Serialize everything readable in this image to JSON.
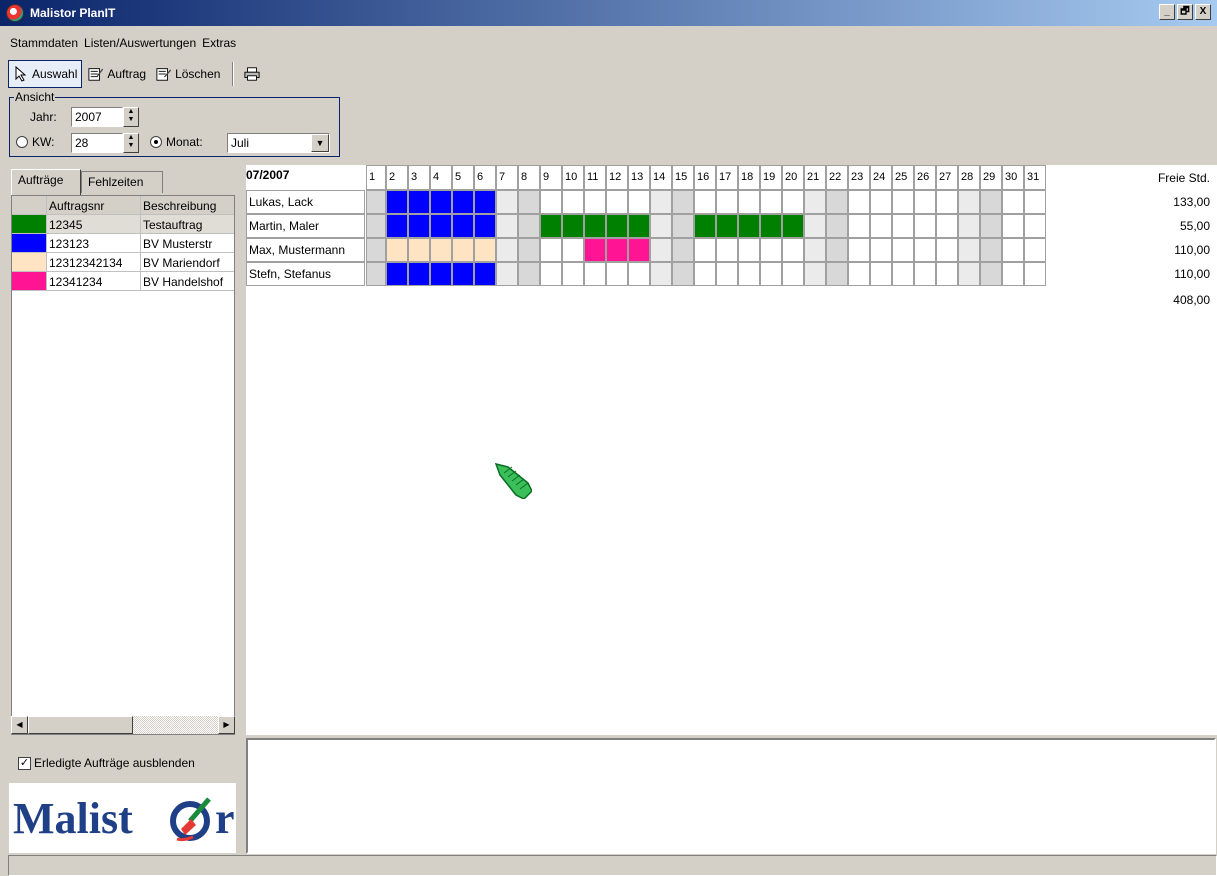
{
  "window": {
    "title": "Malistor PlanIT",
    "btn_min": "_",
    "btn_max": "🗗",
    "btn_close": "X"
  },
  "menu": [
    "Stammdaten",
    "Listen/Auswertungen",
    "Extras"
  ],
  "toolbar": {
    "select_label": "Auswahl",
    "order_label": "Auftrag",
    "delete_label": "Löschen"
  },
  "view": {
    "legend": "Ansicht",
    "year_label": "Jahr:",
    "year_value": "2007",
    "week_label": "KW:",
    "week_value": "28",
    "month_label": "Monat:",
    "month_value": "Juli",
    "mode": "month"
  },
  "left_tabs": [
    "Aufträge",
    "Fehlzeiten"
  ],
  "orders": {
    "col_nr": "Auftragsnr",
    "col_desc": "Beschreibung",
    "rows": [
      {
        "color": "#008000",
        "nr": "12345",
        "desc": "Testauftrag",
        "selected": true
      },
      {
        "color": "#0000ff",
        "nr": "123123",
        "desc": "BV Musterstr",
        "selected": false
      },
      {
        "color": "#ffe4c4",
        "nr": "12312342134",
        "desc": "BV Mariendorf",
        "selected": false
      },
      {
        "color": "#ff1493",
        "nr": "12341234",
        "desc": "BV Handelshof",
        "selected": false
      }
    ]
  },
  "hide_done_label": "Erledigte Aufträge ausblenden",
  "hide_done_checked": true,
  "logo_text": "Malist",
  "logo_r": "r",
  "planner": {
    "period": "07/2007",
    "free_hours_label": "Freie Std.",
    "days": [
      1,
      2,
      3,
      4,
      5,
      6,
      7,
      8,
      9,
      10,
      11,
      12,
      13,
      14,
      15,
      16,
      17,
      18,
      19,
      20,
      21,
      22,
      23,
      24,
      25,
      26,
      27,
      28,
      29,
      30,
      31
    ],
    "weekend_light": [
      7,
      14,
      21,
      28
    ],
    "weekend_dark": [
      1,
      8,
      15,
      22,
      29
    ],
    "employees": [
      {
        "name": "Lukas, Lack",
        "hours": "133,00",
        "assignments": [
          {
            "from": 2,
            "to": 6,
            "color": "#0000ff"
          }
        ]
      },
      {
        "name": "Martin, Maler",
        "hours": "55,00",
        "assignments": [
          {
            "from": 2,
            "to": 6,
            "color": "#0000ff"
          },
          {
            "from": 9,
            "to": 13,
            "color": "#008000"
          },
          {
            "from": 16,
            "to": 20,
            "color": "#008000"
          }
        ]
      },
      {
        "name": "Max, Mustermann",
        "hours": "110,00",
        "assignments": [
          {
            "from": 2,
            "to": 6,
            "color": "#ffe4c4"
          },
          {
            "from": 11,
            "to": 13,
            "color": "#ff1493"
          }
        ]
      },
      {
        "name": "Stefn, Stefanus",
        "hours": "110,00",
        "assignments": [
          {
            "from": 2,
            "to": 6,
            "color": "#0000ff"
          }
        ]
      }
    ],
    "total_hours": "408,00"
  }
}
